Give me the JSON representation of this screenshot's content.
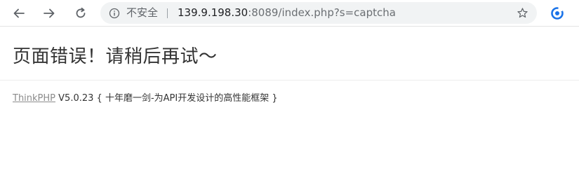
{
  "browser": {
    "security_label": "不安全",
    "url_host": "139.9.198.30",
    "url_rest": ":8089/index.php?s=captcha",
    "icons": {
      "back": "back-arrow-icon",
      "forward": "forward-arrow-icon",
      "reload": "reload-icon",
      "info": "info-icon",
      "bookmark": "star-icon",
      "extension": "extension-icon"
    }
  },
  "page": {
    "error_message": "页面错误！请稍后再试～",
    "framework_link": "ThinkPHP",
    "version": "V5.0.23",
    "tagline": "{ 十年磨一剑-为API开发设计的高性能框架 }"
  },
  "colors": {
    "link": "#8b8b8b",
    "extension_accent": "#1a73e8"
  }
}
